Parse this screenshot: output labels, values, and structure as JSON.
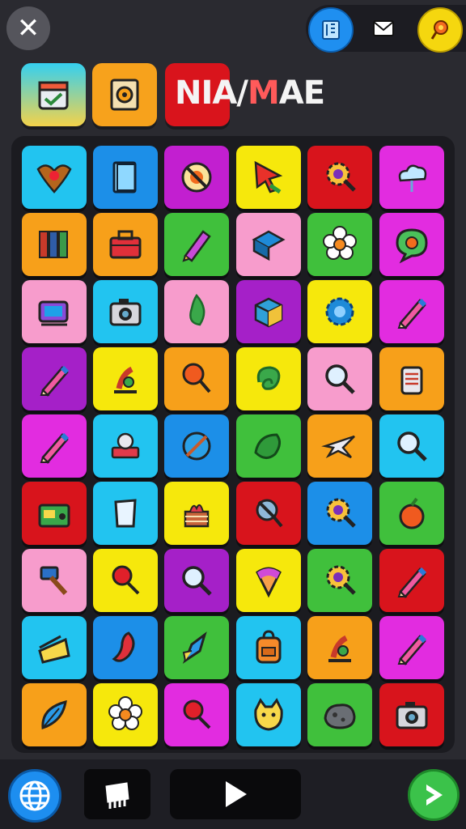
{
  "header": {
    "close_icon": "close-icon",
    "right_icons": [
      "map-icon",
      "mail-icon",
      "location-pin-icon"
    ]
  },
  "toolbar": {
    "slots": [
      "calendar-icon",
      "gear-document-icon",
      "red-slot"
    ],
    "title": "NIA/MAE",
    "title_parts": [
      "NIA/",
      "M",
      "AE"
    ]
  },
  "grid": {
    "columns": 6,
    "rows": 9,
    "tiles": [
      {
        "icon": "eagle-crest-icon",
        "bg": "#22c4f0"
      },
      {
        "icon": "book-icon",
        "bg": "#1c8fe8"
      },
      {
        "icon": "orange-disc-icon",
        "bg": "#c21fd0"
      },
      {
        "icon": "cursor-arrow-icon",
        "bg": "#f6e80c"
      },
      {
        "icon": "gear-magnifier-icon",
        "bg": "#d8141c"
      },
      {
        "icon": "cloud-icon",
        "bg": "#e22ce0"
      },
      {
        "icon": "books-icon",
        "bg": "#f7a01a"
      },
      {
        "icon": "toolbox-icon",
        "bg": "#f7a01a"
      },
      {
        "icon": "crayon-icon",
        "bg": "#40c03c"
      },
      {
        "icon": "gem-box-icon",
        "bg": "#f79ccc"
      },
      {
        "icon": "flower-icon",
        "bg": "#40c03c"
      },
      {
        "icon": "speech-bubble-icon",
        "bg": "#e22ce0"
      },
      {
        "icon": "projector-icon",
        "bg": "#f79ccc"
      },
      {
        "icon": "camera-icon",
        "bg": "#22c4f0"
      },
      {
        "icon": "leaf-icon",
        "bg": "#f79ccc"
      },
      {
        "icon": "cube-icon",
        "bg": "#a520c8"
      },
      {
        "icon": "gear-flower-icon",
        "bg": "#f6e80c"
      },
      {
        "icon": "pencil-icon",
        "bg": "#e22ce0"
      },
      {
        "icon": "pencil-icon",
        "bg": "#a520c8"
      },
      {
        "icon": "microscope-icon",
        "bg": "#f6e80c"
      },
      {
        "icon": "lollipop-icon",
        "bg": "#f7a01a"
      },
      {
        "icon": "swirl-icon",
        "bg": "#f6e80c"
      },
      {
        "icon": "magnifier-icon",
        "bg": "#f79ccc"
      },
      {
        "icon": "jar-icon",
        "bg": "#f7a01a"
      },
      {
        "icon": "pencil-icon",
        "bg": "#e22ce0"
      },
      {
        "icon": "stamp-icon",
        "bg": "#22c4f0"
      },
      {
        "icon": "slash-circle-icon",
        "bg": "#1c8fe8"
      },
      {
        "icon": "pickle-icon",
        "bg": "#40c03c"
      },
      {
        "icon": "plane-icon",
        "bg": "#f7a01a"
      },
      {
        "icon": "magnifier-icon",
        "bg": "#22c4f0"
      },
      {
        "icon": "radio-icon",
        "bg": "#d8141c"
      },
      {
        "icon": "glass-icon",
        "bg": "#22c4f0"
      },
      {
        "icon": "cake-icon",
        "bg": "#f6e80c"
      },
      {
        "icon": "search-cross-icon",
        "bg": "#d8141c"
      },
      {
        "icon": "gear-magnifier-icon",
        "bg": "#1c8fe8"
      },
      {
        "icon": "fruit-icon",
        "bg": "#40c03c"
      },
      {
        "icon": "hammer-icon",
        "bg": "#f79ccc"
      },
      {
        "icon": "pin-icon",
        "bg": "#f6e80c"
      },
      {
        "icon": "magnifier-icon",
        "bg": "#a520c8"
      },
      {
        "icon": "cone-icon",
        "bg": "#f6e80c"
      },
      {
        "icon": "gear-magnifier-icon",
        "bg": "#40c03c"
      },
      {
        "icon": "pencil-icon",
        "bg": "#d8141c"
      },
      {
        "icon": "cheese-icon",
        "bg": "#22c4f0"
      },
      {
        "icon": "chili-icon",
        "bg": "#1c8fe8"
      },
      {
        "icon": "rocket-icon",
        "bg": "#40c03c"
      },
      {
        "icon": "backpack-icon",
        "bg": "#22c4f0"
      },
      {
        "icon": "microscope-icon",
        "bg": "#f7a01a"
      },
      {
        "icon": "pencil-icon",
        "bg": "#e22ce0"
      },
      {
        "icon": "feather-icon",
        "bg": "#f7a01a"
      },
      {
        "icon": "flower-icon",
        "bg": "#f6e80c"
      },
      {
        "icon": "pin-icon",
        "bg": "#e22ce0"
      },
      {
        "icon": "monster-icon",
        "bg": "#22c4f0"
      },
      {
        "icon": "rock-icon",
        "bg": "#40c03c"
      },
      {
        "icon": "camera-icon",
        "bg": "#d8141c"
      }
    ]
  },
  "footer": {
    "left_icon": "globe-icon",
    "chip_icon": "chip-icon",
    "play_icon": "play-icon",
    "next_icon": "next-arrow-icon"
  }
}
